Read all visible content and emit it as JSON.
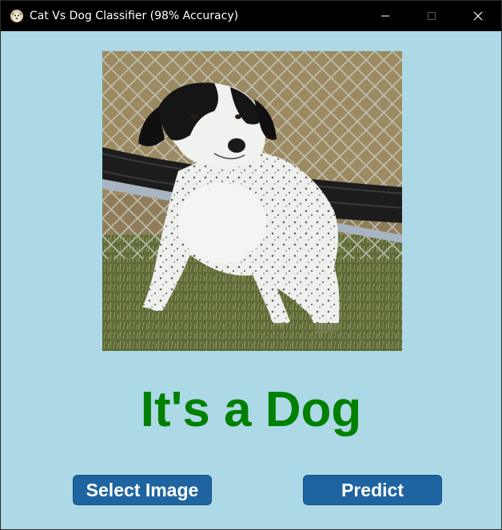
{
  "window": {
    "title": "Cat Vs Dog Classifier (98% Accuracy)",
    "controls": {
      "minimize_icon": "minimize-icon",
      "maximize_icon": "maximize-icon",
      "close_icon": "close-icon"
    }
  },
  "image": {
    "subject": "dog-photo"
  },
  "result": {
    "label": "It's a Dog",
    "color": "#008000"
  },
  "buttons": {
    "select_label": "Select Image",
    "predict_label": "Predict",
    "color": "#1e64a0"
  },
  "theme": {
    "background": "#add8e6",
    "titlebar": "#000000"
  }
}
